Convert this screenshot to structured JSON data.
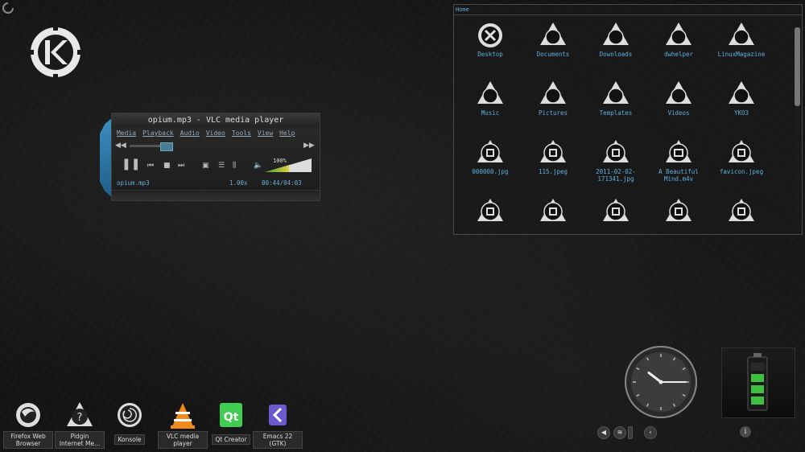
{
  "vlc": {
    "title": "opium.mp3 - VLC media player",
    "menu": [
      "Media",
      "Playback",
      "Audio",
      "Video",
      "Tools",
      "View",
      "Help"
    ],
    "file": "opium.mp3",
    "speed": "1.00x",
    "time": "00:44/04:03",
    "volume": "100%",
    "seek_progress": 0.18
  },
  "folder": {
    "title": "Home",
    "items": [
      {
        "label": "Desktop",
        "icon": "desktop-icon"
      },
      {
        "label": "Documents",
        "icon": "folder-icon"
      },
      {
        "label": "Downloads",
        "icon": "folder-icon"
      },
      {
        "label": "dwhelper",
        "icon": "folder-icon"
      },
      {
        "label": "LinuxMagazine",
        "icon": "folder-icon"
      },
      {
        "label": "Music",
        "icon": "folder-icon"
      },
      {
        "label": "Pictures",
        "icon": "folder-icon"
      },
      {
        "label": "Templates",
        "icon": "folder-icon"
      },
      {
        "label": "Videos",
        "icon": "folder-icon"
      },
      {
        "label": "YKO3",
        "icon": "folder-icon"
      },
      {
        "label": "000000.jpg",
        "icon": "image-icon"
      },
      {
        "label": "115.jpeg",
        "icon": "image-icon"
      },
      {
        "label": "2011-02-02-171341.jpg",
        "icon": "image-icon"
      },
      {
        "label": "A Beautiful Mind.m4v",
        "icon": "video-icon"
      },
      {
        "label": "favicon.jpeg",
        "icon": "image-icon"
      },
      {
        "label": "",
        "icon": "image-icon"
      },
      {
        "label": "",
        "icon": "image-icon"
      },
      {
        "label": "",
        "icon": "image-icon"
      },
      {
        "label": "",
        "icon": "image-icon"
      },
      {
        "label": "",
        "icon": "image-icon"
      }
    ]
  },
  "taskbar": [
    {
      "label": "Firefox Web Browser",
      "icon": "firefox-icon"
    },
    {
      "label": "Pidgin Internet Me...",
      "icon": "pidgin-icon"
    },
    {
      "label": "Konsole",
      "icon": "konsole-icon"
    },
    {
      "label": "VLC media player",
      "icon": "vlc-icon"
    },
    {
      "label": "Qt Creator",
      "icon": "qt-creator-icon"
    },
    {
      "label": "Emacs 22 (GTK)",
      "icon": "emacs-icon"
    }
  ],
  "clock": {
    "hour": 10,
    "minute": 15
  },
  "battery": {
    "level": 0.75
  },
  "accent": "#5fb0e0"
}
